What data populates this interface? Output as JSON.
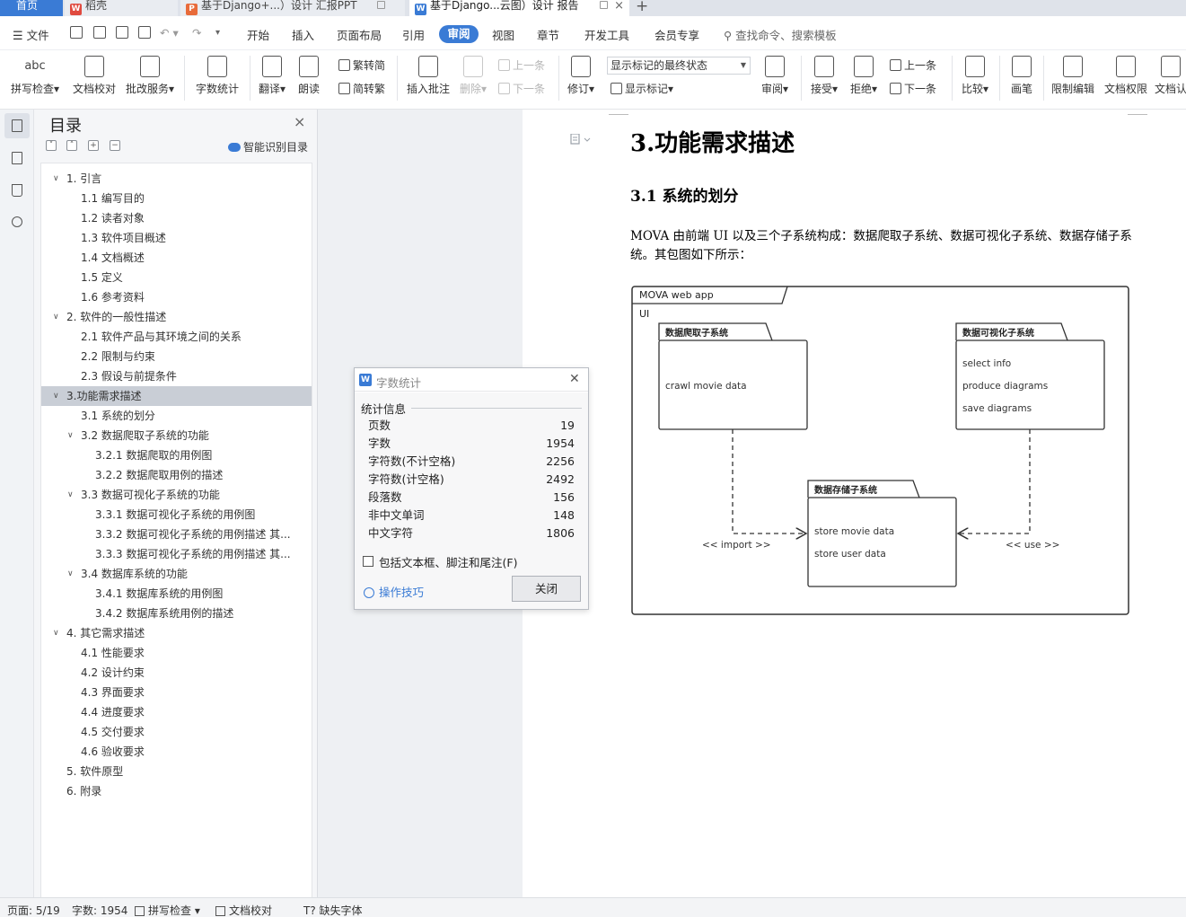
{
  "tabs": {
    "home": "首页",
    "t1": "稻壳",
    "t2": "基于Django+...）设计 汇报PPT",
    "t3": "基于Django...云图）设计 报告",
    "add": "+"
  },
  "menubar": {
    "file": "文件",
    "items": [
      "开始",
      "插入",
      "页面布局",
      "引用",
      "审阅",
      "视图",
      "章节",
      "开发工具",
      "会员专享"
    ],
    "search": "查找命令、搜索模板"
  },
  "ribbon": {
    "spell": "拼写检查",
    "doc_check": "文档校对",
    "batch": "批改服务",
    "word_count": "字数统计",
    "translate": "翻译",
    "read": "朗读",
    "trad_to_simp": "繁转简",
    "simp_to_trad": "简转繁",
    "insert_comment": "插入批注",
    "delete": "删除",
    "prev": "上一条",
    "next": "下一条",
    "revise": "修订",
    "markup_state": "显示标记的最终状态",
    "show_markup": "显示标记",
    "review": "审阅",
    "accept": "接受",
    "reject": "拒绝",
    "prev2": "上一条",
    "next2": "下一条",
    "compare": "比较",
    "pen": "画笔",
    "restrict": "限制编辑",
    "permission": "文档权限",
    "doc_cert": "文档认"
  },
  "toc": {
    "title": "目录",
    "smart": "智能识别目录",
    "items": [
      {
        "text": "1.  引言",
        "level": 1,
        "chev": "open"
      },
      {
        "text": "1.1  编写目的",
        "level": 2
      },
      {
        "text": "1.2  读者对象",
        "level": 2
      },
      {
        "text": "1.3  软件项目概述",
        "level": 2
      },
      {
        "text": "1.4  文档概述",
        "level": 2
      },
      {
        "text": "1.5  定义",
        "level": 2
      },
      {
        "text": "1.6  参考资料",
        "level": 2
      },
      {
        "text": "2.  软件的一般性描述",
        "level": 1,
        "chev": "open"
      },
      {
        "text": "2.1 软件产品与其环境之间的关系",
        "level": 2
      },
      {
        "text": "2.2 限制与约束",
        "level": 2
      },
      {
        "text": "2.3 假设与前提条件",
        "level": 2
      },
      {
        "text": "3.功能需求描述",
        "level": 1,
        "chev": "open",
        "selected": true
      },
      {
        "text": "3.1 系统的划分",
        "level": 2
      },
      {
        "text": "3.2  数据爬取子系统的功能",
        "level": 2,
        "chev": "open"
      },
      {
        "text": "3.2.1  数据爬取的用例图",
        "level": 3
      },
      {
        "text": "3.2.2  数据爬取用例的描述",
        "level": 3
      },
      {
        "text": "3.3  数据可视化子系统的功能",
        "level": 2,
        "chev": "open"
      },
      {
        "text": "3.3.1  数据可视化子系统的用例图",
        "level": 3
      },
      {
        "text": "3.3.2  数据可视化子系统的用例描述  其...",
        "level": 3
      },
      {
        "text": "3.3.3  数据可视化子系统的用例描述  其...",
        "level": 3
      },
      {
        "text": "3.4  数据库系统的功能",
        "level": 2,
        "chev": "open"
      },
      {
        "text": "3.4.1  数据库系统的用例图",
        "level": 3
      },
      {
        "text": "3.4.2  数据库系统用例的描述",
        "level": 3
      },
      {
        "text": "4.  其它需求描述",
        "level": 1,
        "chev": "open"
      },
      {
        "text": "4.1  性能要求",
        "level": 2
      },
      {
        "text": "4.2  设计约束",
        "level": 2
      },
      {
        "text": "4.3  界面要求",
        "level": 2
      },
      {
        "text": "4.4  进度要求",
        "level": 2
      },
      {
        "text": "4.5  交付要求",
        "level": 2
      },
      {
        "text": "4.6  验收要求",
        "level": 2
      },
      {
        "text": "5.  软件原型",
        "level": 1
      },
      {
        "text": "6.  附录",
        "level": 1
      }
    ]
  },
  "doc": {
    "h1": "3.功能需求描述",
    "h2": "3.1 系统的划分",
    "para": "MOVA 由前端 UI 以及三个子系统构成：数据爬取子系统、数据可视化子系统、数据存储子系统。其包图如下所示："
  },
  "diagram": {
    "frame_title": "MOVA web app",
    "ui_label": "UI",
    "crawl_title": "数据爬取子系统",
    "crawl_items": [
      "crawl movie data"
    ],
    "viz_title": "数据可视化子系统",
    "viz_items": [
      "select info",
      "produce diagrams",
      "save diagrams"
    ],
    "store_title": "数据存储子系统",
    "store_items": [
      "store movie data",
      "store user data"
    ],
    "import_label": "<< import >>",
    "use_label": "<< use >>"
  },
  "wordcount": {
    "title": "字数统计",
    "section": "统计信息",
    "rows": [
      {
        "label": "页数",
        "value": "19"
      },
      {
        "label": "字数",
        "value": "1954"
      },
      {
        "label": "字符数(不计空格)",
        "value": "2256"
      },
      {
        "label": "字符数(计空格)",
        "value": "2492"
      },
      {
        "label": "段落数",
        "value": "156"
      },
      {
        "label": "非中文单词",
        "value": "148"
      },
      {
        "label": "中文字符",
        "value": "1806"
      }
    ],
    "include_label": "包括文本框、脚注和尾注(F)",
    "tips": "操作技巧",
    "close_btn": "关闭"
  },
  "status": {
    "page": "页面: 5/19",
    "words": "字数: 1954",
    "spell": "拼写检查",
    "doc_check": "文档校对",
    "missing_font": "缺失字体"
  },
  "colors": {
    "accent": "#3a7bd5",
    "selected": "#c9ced6"
  }
}
